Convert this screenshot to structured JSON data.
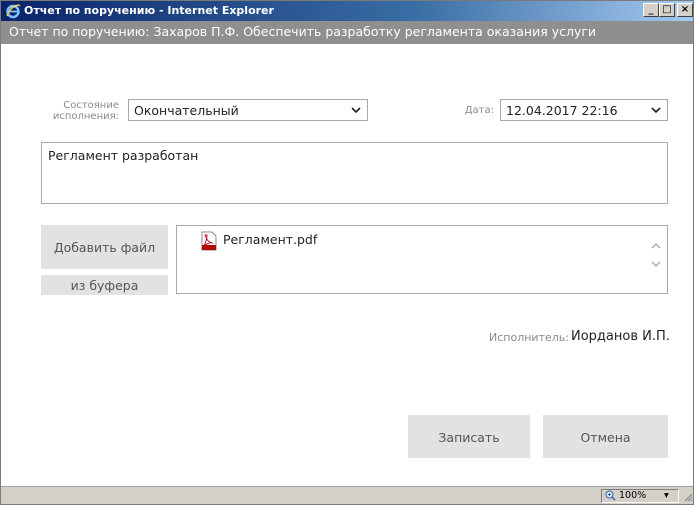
{
  "window": {
    "title": "Отчет по поручению - Internet Explorer",
    "minimize": "_",
    "maximize": "□",
    "close": "×"
  },
  "dialog": {
    "header": "Отчет по поручению: Захаров П.Ф. Обеспечить разработку регламента оказания услуги"
  },
  "form": {
    "state_label_line1": "Состояние",
    "state_label_line2": "исполнения:",
    "state_value": "Окончательный",
    "date_label": "Дата:",
    "date_value": "12.04.2017 22:16",
    "report_text": "Регламент разработан",
    "add_file_label": "Добавить файл",
    "from_buffer_label": "из буфера",
    "files": [
      "Регламент.pdf"
    ],
    "executor_label": "Исполнитель:",
    "executor_value": "Иорданов И.П.",
    "save_label": "Записать",
    "cancel_label": "Отмена"
  },
  "statusbar": {
    "zoom": "100%",
    "zoom_arrow": "▾"
  },
  "colors": {
    "header_bg": "#8f8f8f",
    "button_bg": "#e2e2e2",
    "titlebar_start": "#0a246a"
  },
  "icons": [
    "ie-icon",
    "chevron-down-icon",
    "pdf-icon",
    "scroll-up-icon",
    "scroll-down-icon",
    "zoom-icon",
    "resize-grip-icon"
  ]
}
